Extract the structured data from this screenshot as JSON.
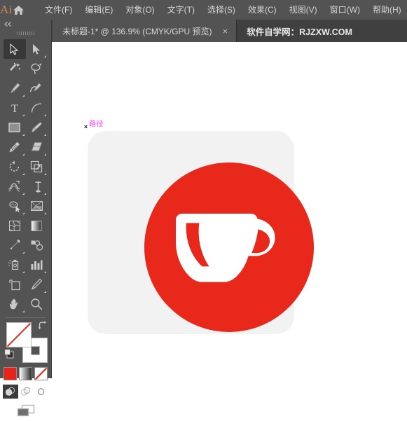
{
  "app": {
    "logo_text": "Ai",
    "home_icon": "home-icon"
  },
  "menubar": {
    "items": [
      {
        "label": "文件(F)",
        "name": "menu-file"
      },
      {
        "label": "编辑(E)",
        "name": "menu-edit"
      },
      {
        "label": "对象(O)",
        "name": "menu-object"
      },
      {
        "label": "文字(T)",
        "name": "menu-type"
      },
      {
        "label": "选择(S)",
        "name": "menu-select"
      },
      {
        "label": "效果(C)",
        "name": "menu-effect"
      },
      {
        "label": "视图(V)",
        "name": "menu-view"
      },
      {
        "label": "窗口(W)",
        "name": "menu-window"
      },
      {
        "label": "帮助(H)",
        "name": "menu-help"
      }
    ]
  },
  "tabbar": {
    "document_tab": {
      "title": "未标题-1* @ 136.9% (CMYK/GPU 预览)",
      "close_label": "×",
      "zoom_level": "136.9%",
      "color_mode": "CMYK",
      "preview_mode": "GPU 预览",
      "modified": true
    },
    "watermark": "软件自学网：RJZXW.COM"
  },
  "toolbar": {
    "collapse_label": "◄◄",
    "tools": [
      {
        "name": "selection-tool",
        "label": "选择工具",
        "active": true,
        "has_flyout": false
      },
      {
        "name": "direct-selection-tool",
        "label": "直接选择工具",
        "active": false,
        "has_flyout": true
      },
      {
        "name": "magic-wand-tool",
        "label": "魔棒工具",
        "active": false,
        "has_flyout": false
      },
      {
        "name": "lasso-tool",
        "label": "套索工具",
        "active": false,
        "has_flyout": false
      },
      {
        "name": "pen-tool",
        "label": "钢笔工具",
        "active": false,
        "has_flyout": true
      },
      {
        "name": "curvature-tool",
        "label": "曲率工具",
        "active": false,
        "has_flyout": false
      },
      {
        "name": "type-tool",
        "label": "文字工具",
        "active": false,
        "has_flyout": true
      },
      {
        "name": "line-segment-tool",
        "label": "直线段工具",
        "active": false,
        "has_flyout": true
      },
      {
        "name": "rectangle-tool",
        "label": "矩形工具",
        "active": false,
        "has_flyout": true
      },
      {
        "name": "paintbrush-tool",
        "label": "画笔工具",
        "active": false,
        "has_flyout": true
      },
      {
        "name": "shaper-pencil-tool",
        "label": "Shaper 工具",
        "active": false,
        "has_flyout": true
      },
      {
        "name": "eraser-tool",
        "label": "橡皮擦工具",
        "active": false,
        "has_flyout": true
      },
      {
        "name": "rotate-tool",
        "label": "旋转工具",
        "active": false,
        "has_flyout": true
      },
      {
        "name": "scale-tool",
        "label": "比例缩放工具",
        "active": false,
        "has_flyout": true
      },
      {
        "name": "width-tool",
        "label": "宽度工具",
        "active": false,
        "has_flyout": true
      },
      {
        "name": "free-transform-tool",
        "label": "自由变换工具",
        "active": false,
        "has_flyout": true
      },
      {
        "name": "shape-builder-tool",
        "label": "形状生成器工具",
        "active": false,
        "has_flyout": true
      },
      {
        "name": "perspective-grid-tool",
        "label": "透视网格工具",
        "active": false,
        "has_flyout": true
      },
      {
        "name": "mesh-tool",
        "label": "网格工具",
        "active": false,
        "has_flyout": false
      },
      {
        "name": "gradient-tool",
        "label": "渐变工具",
        "active": false,
        "has_flyout": false
      },
      {
        "name": "eyedropper-tool",
        "label": "吸管工具",
        "active": false,
        "has_flyout": true
      },
      {
        "name": "blend-tool",
        "label": "混合工具",
        "active": false,
        "has_flyout": false
      },
      {
        "name": "symbol-sprayer-tool",
        "label": "符号喷枪工具",
        "active": false,
        "has_flyout": true
      },
      {
        "name": "column-graph-tool",
        "label": "柱形图工具",
        "active": false,
        "has_flyout": true
      },
      {
        "name": "artboard-tool",
        "label": "画板工具",
        "active": false,
        "has_flyout": false
      },
      {
        "name": "slice-tool",
        "label": "切片工具",
        "active": false,
        "has_flyout": true
      },
      {
        "name": "hand-tool",
        "label": "抓手工具",
        "active": false,
        "has_flyout": true
      },
      {
        "name": "zoom-tool",
        "label": "缩放工具",
        "active": false,
        "has_flyout": false
      }
    ],
    "fill_color": "#ffffff",
    "fill_is_none": true,
    "stroke_color": "#ffffff",
    "stroke_is_none": false,
    "swap_icon": "swap-fill-stroke-icon",
    "default_icon": "default-fill-stroke-icon",
    "fill_types": [
      {
        "name": "fill-type-color",
        "label": "颜色",
        "swatch": "#e8241a",
        "active": false
      },
      {
        "name": "fill-type-gradient",
        "label": "渐变",
        "swatch": "gradient",
        "active": false
      },
      {
        "name": "fill-type-none",
        "label": "无",
        "swatch": "none",
        "active": true
      }
    ],
    "draw_modes": [
      {
        "name": "draw-normal-mode",
        "label": "正常绘图",
        "active": true
      },
      {
        "name": "draw-behind-mode",
        "label": "背面绘图",
        "active": false
      },
      {
        "name": "draw-inside-mode",
        "label": "内部绘图",
        "active": false
      }
    ],
    "screen_mode": {
      "name": "screen-mode-button",
      "label": "更改屏幕模式"
    }
  },
  "canvas": {
    "background": "#ffffff",
    "artboard_color": "#f2f2f2",
    "selection": {
      "label": "路径",
      "label_color": "#ff3fff",
      "anchor_glyph": "×"
    },
    "artwork": {
      "name": "coffee-cup-icon",
      "circle_color": "#e8281b",
      "cup_color": "#ffffff",
      "rounded_square_color": "#f2f2f2"
    }
  }
}
